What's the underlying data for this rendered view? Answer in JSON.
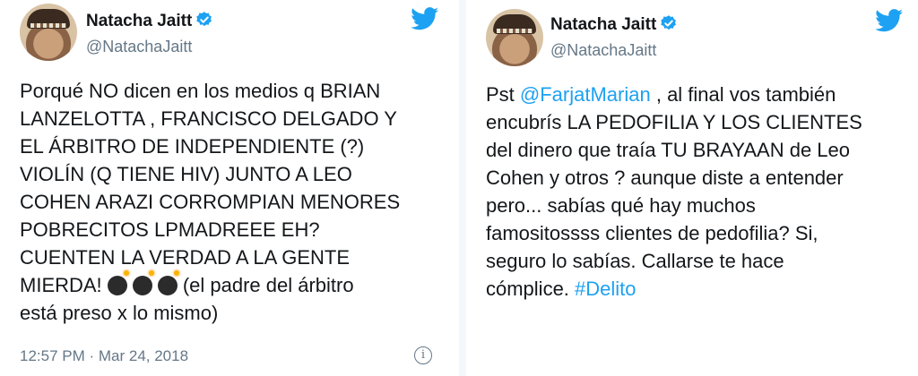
{
  "tweets": [
    {
      "author": "Natacha Jaitt",
      "handle": "@NatachaJaitt",
      "text": "Porqué NO dicen en los medios q BRIAN\nLANZELOTTA , FRANCISCO DELGADO Y\nEL ÁRBITRO DE INDEPENDIENTE (?)\nVIOLÍN (Q TIENE HIV) JUNTO A LEO\nCOHEN ARAZI CORROMPIAN MENORES\nPOBRECITOS LPMADREEE EH?\nCUENTEN LA VERDAD A LA GENTE\nMIERDA!",
      "text_after_emoji": "(el padre del árbitro\nestá preso x lo mismo)",
      "emoji_names": [
        "bomb-emoji",
        "bomb-emoji",
        "bomb-emoji"
      ],
      "timestamp": "12:57 PM · Mar 24, 2018",
      "info_icon": "info-icon"
    },
    {
      "author": "Natacha Jaitt",
      "handle": "@NatachaJaitt",
      "text_prefix": "Pst ",
      "mention": "@FarjatMarian",
      "text_body": " , al final vos también\nencubrís LA PEDOFILIA Y LOS CLIENTES\ndel dinero que traía TU BRAYAAN de Leo\nCohen y otros ? aunque diste a entender\npero... sabías qué hay muchos\nfamositossss clientes de pedofilia? Si,\nseguro lo sabías. Callarse te hace\ncómplice. ",
      "hashtag": "#Delito"
    }
  ],
  "colors": {
    "brand": "#1da1f2",
    "text": "#14171a",
    "muted": "#657786"
  },
  "icons": {
    "logo": "twitter-bird-icon",
    "verified": "verified-badge-icon"
  }
}
